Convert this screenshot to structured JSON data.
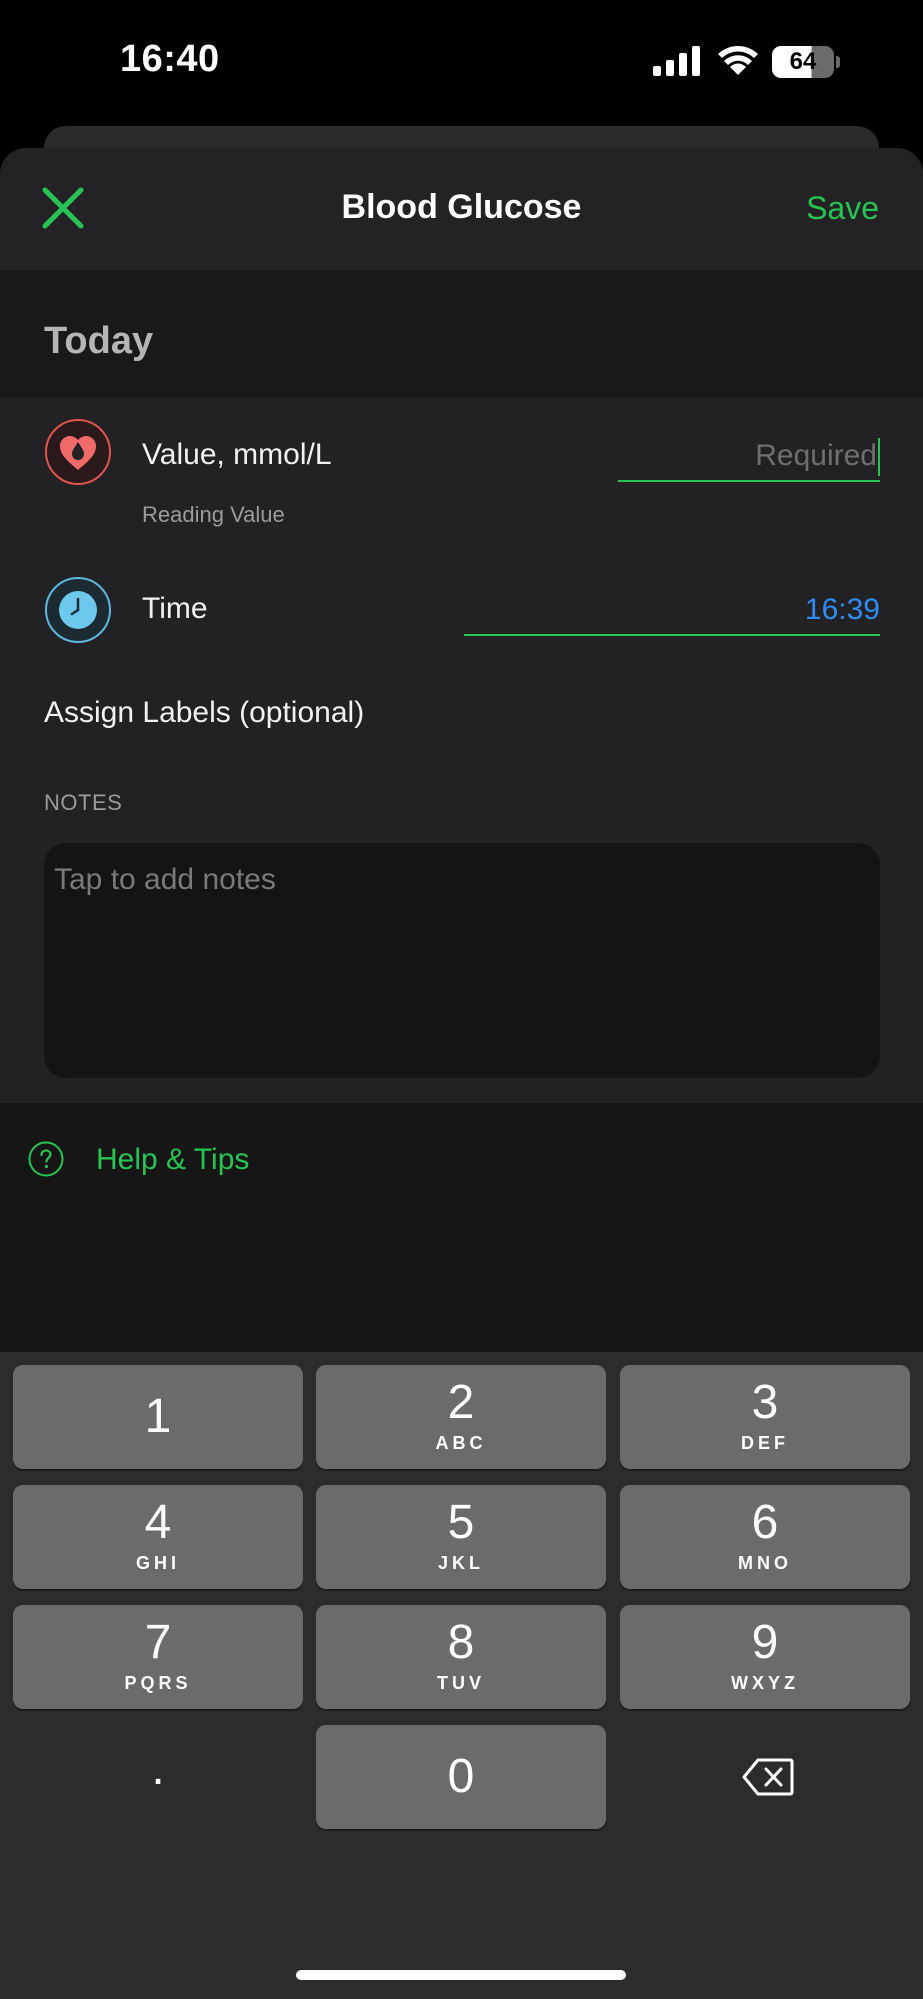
{
  "status_bar": {
    "time": "16:40",
    "battery_level": "64",
    "icons": [
      "cellular-signal-icon",
      "wifi-icon",
      "battery-icon"
    ]
  },
  "nav": {
    "close_icon": "close-x-icon",
    "title": "Blood Glucose",
    "save_label": "Save"
  },
  "date_header": "Today",
  "form": {
    "value_row": {
      "icon": "blood-drop-heart-icon",
      "label": "Value, mmol/L",
      "sublabel": "Reading Value",
      "placeholder": "Required"
    },
    "time_row": {
      "icon": "clock-icon",
      "label": "Time",
      "value": "16:39"
    },
    "assign_labels": "Assign Labels (optional)",
    "notes_label": "NOTES",
    "notes_placeholder": "Tap to add notes"
  },
  "help": {
    "icon": "question-circle-icon",
    "label": "Help & Tips"
  },
  "keypad": {
    "keys": [
      {
        "digit": "1",
        "letters": ""
      },
      {
        "digit": "2",
        "letters": "ABC"
      },
      {
        "digit": "3",
        "letters": "DEF"
      },
      {
        "digit": "4",
        "letters": "GHI"
      },
      {
        "digit": "5",
        "letters": "JKL"
      },
      {
        "digit": "6",
        "letters": "MNO"
      },
      {
        "digit": "7",
        "letters": "PQRS"
      },
      {
        "digit": "8",
        "letters": "TUV"
      },
      {
        "digit": "9",
        "letters": "WXYZ"
      },
      {
        "digit": "0",
        "letters": ""
      }
    ],
    "decimal_label": ".",
    "backspace_icon": "backspace-icon"
  },
  "colors": {
    "accent_green": "#27c454",
    "time_blue": "#2f8cf5",
    "glucose_red": "#f06a6a",
    "clock_blue": "#6dc8ee"
  }
}
